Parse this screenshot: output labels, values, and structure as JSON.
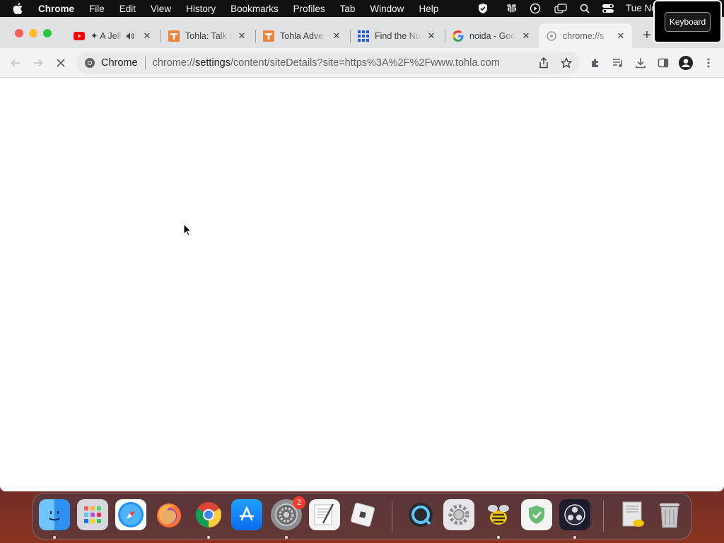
{
  "menubar": {
    "app_name": "Chrome",
    "items": [
      "File",
      "Edit",
      "View",
      "History",
      "Bookmarks",
      "Profiles",
      "Tab",
      "Window",
      "Help"
    ],
    "clock": "Tue Nc",
    "status_icons": [
      "shield-icon",
      "bee-icon",
      "play-circle-icon",
      "screen-mirroring-icon",
      "search-icon",
      "control-center-icon"
    ]
  },
  "keyboard_popup": {
    "label": "Keyboard"
  },
  "tabs": [
    {
      "title": "✦ A Jell",
      "favicon": "youtube-icon",
      "audio": true
    },
    {
      "title": "Tohla: Talk t",
      "favicon": "tohla-icon"
    },
    {
      "title": "Tohla Adve",
      "favicon": "tohla-icon"
    },
    {
      "title": "Find the Nu",
      "favicon": "grid-icon"
    },
    {
      "title": "noida - Goo",
      "favicon": "google-icon"
    },
    {
      "title": "chrome://s",
      "favicon": "settings-icon",
      "active": true
    }
  ],
  "omnibox": {
    "chip": "Chrome",
    "url_scheme": "chrome://",
    "url_host": "settings",
    "url_path": "/content/siteDetails?site=https%3A%2F%2Fwww.tohla.com"
  },
  "dock": {
    "apps": [
      "Finder",
      "Launchpad",
      "Safari",
      "Firefox",
      "Google Chrome",
      "App Store",
      "System Preferences",
      "TextEdit",
      "Roblox",
      "QuickTime",
      "Settings",
      "Bee",
      "AdGuard",
      "OBS",
      "Archive",
      "Trash"
    ],
    "system_preferences_badge": "2"
  },
  "colors": {
    "tabstrip": "#dfe1e5",
    "toolbar": "#f1f3f4",
    "omnibox": "#e8eaed",
    "content": "#ffffff"
  }
}
